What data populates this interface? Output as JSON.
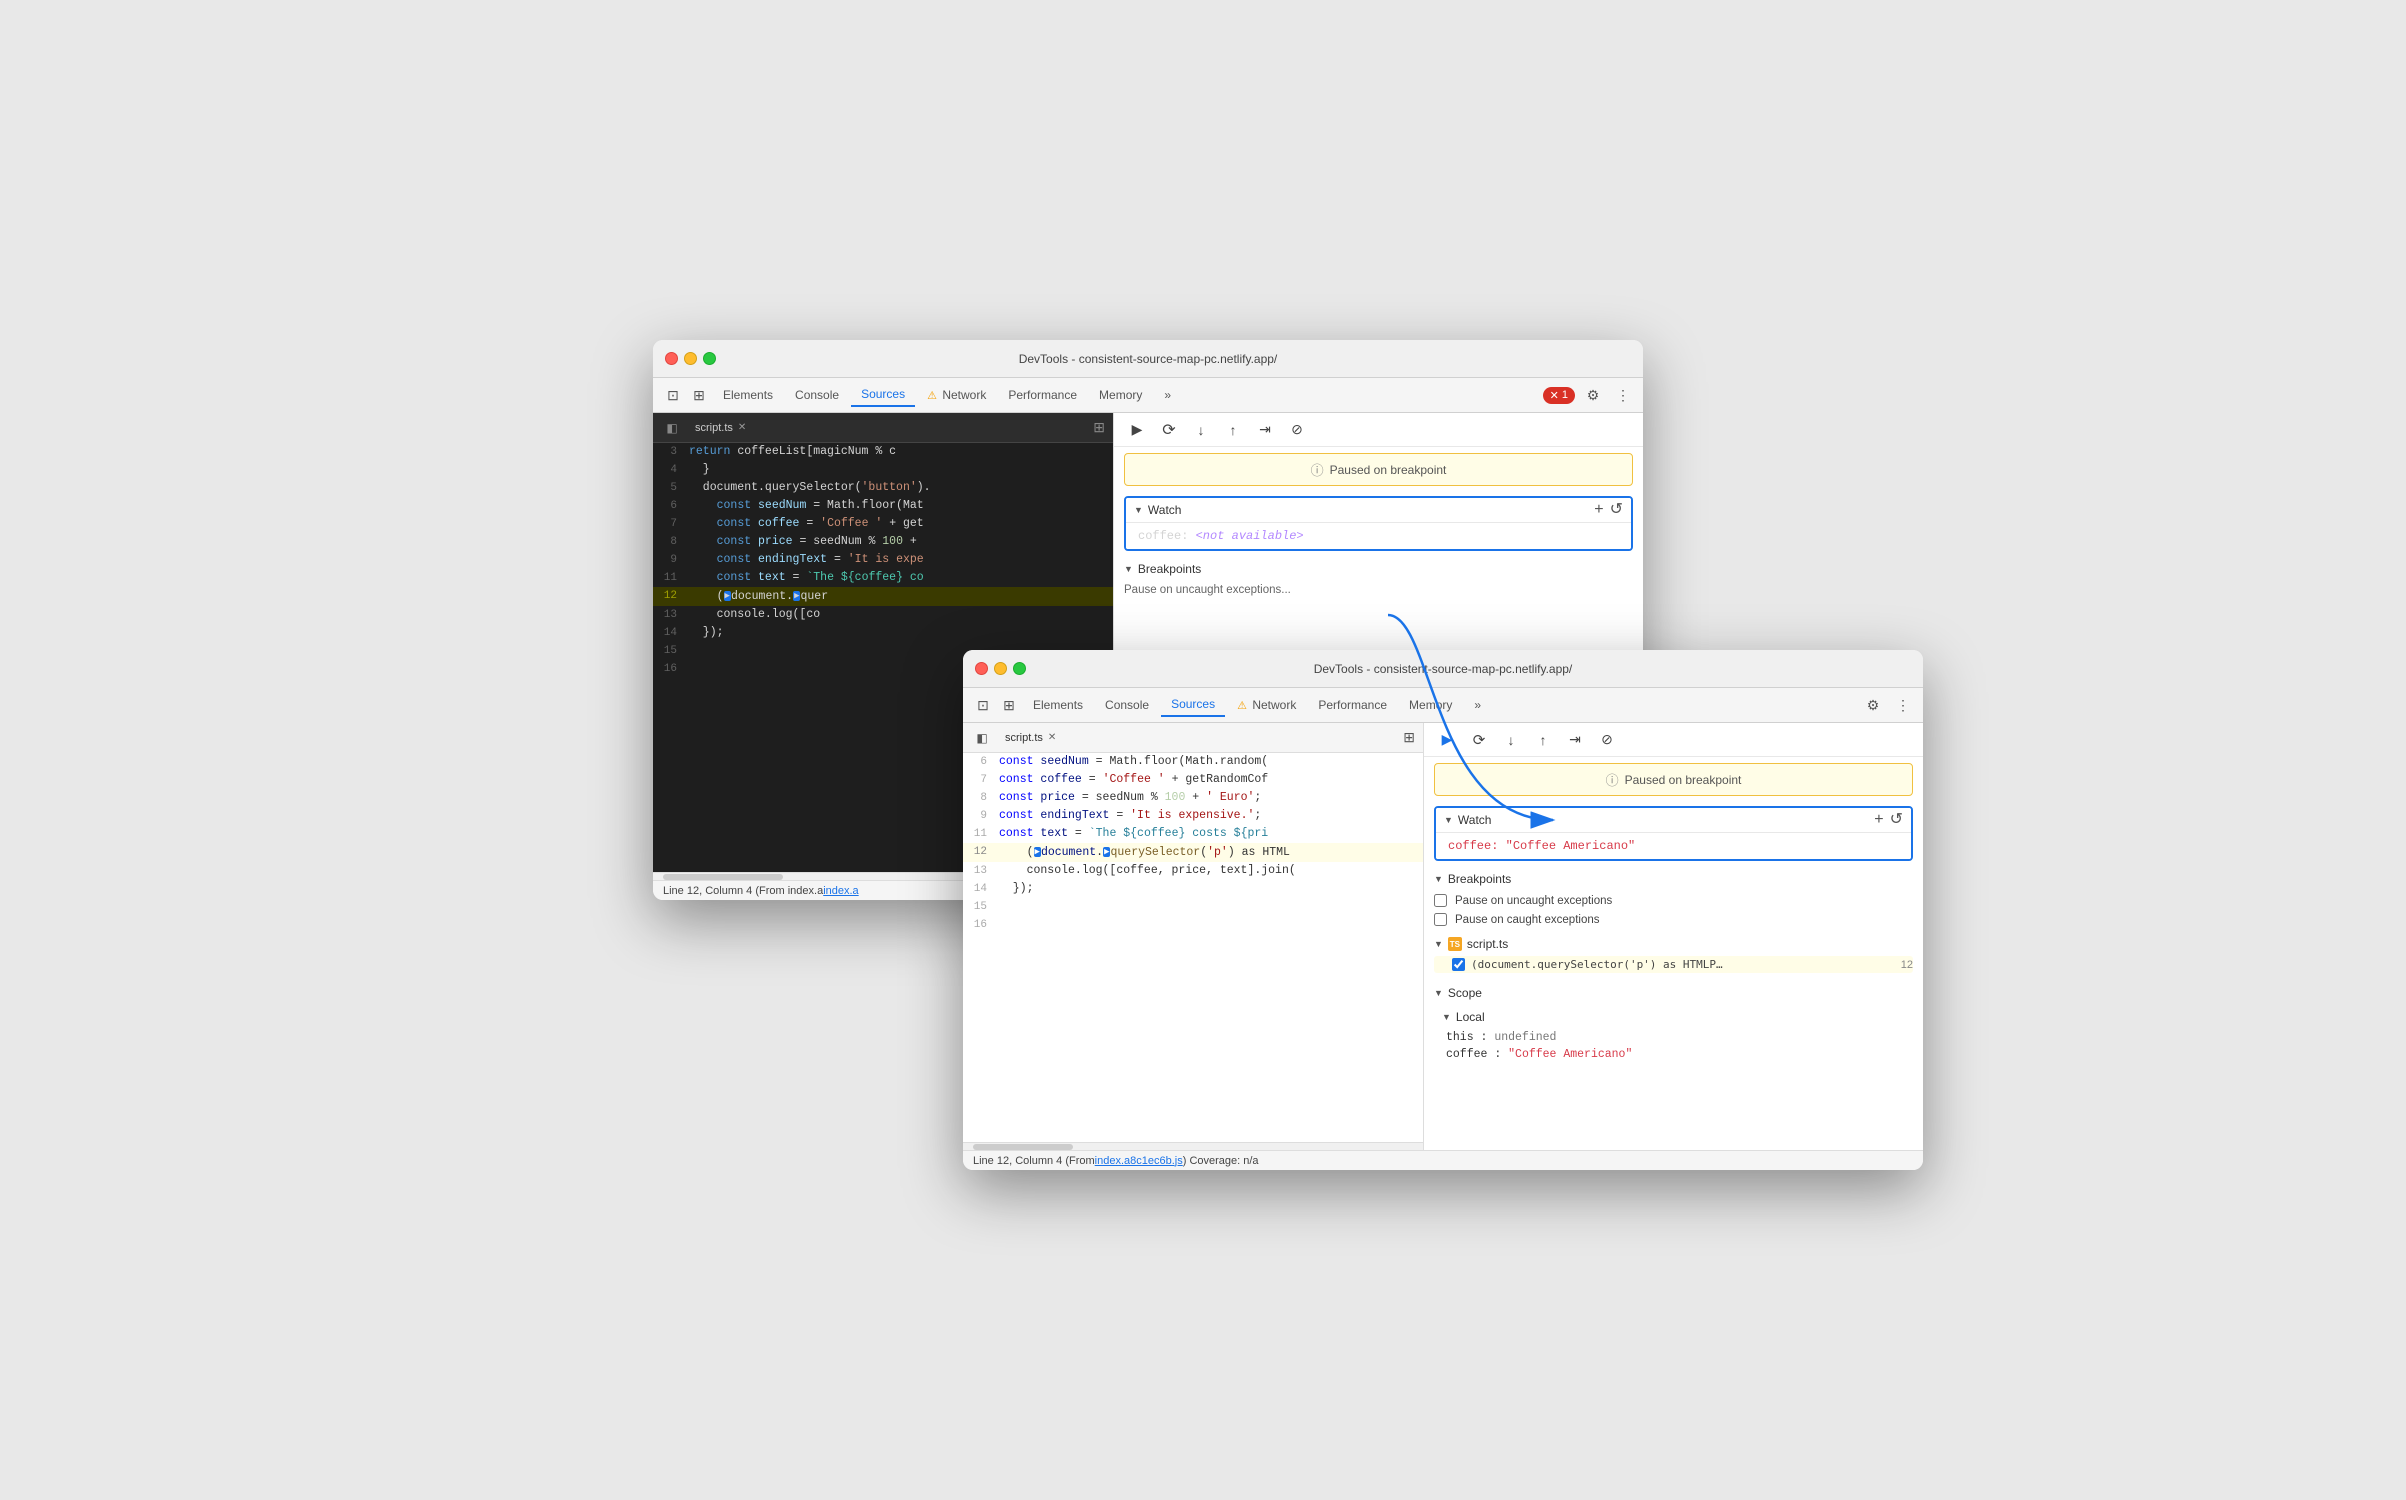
{
  "window_back": {
    "title": "DevTools - consistent-source-map-pc.netlify.app/",
    "tabs": [
      "Elements",
      "Console",
      "Sources",
      "Network",
      "Performance",
      "Memory"
    ],
    "active_tab": "Sources",
    "warning_tab": "Network",
    "error_count": "1",
    "source_file": "script.ts",
    "code_lines": [
      {
        "num": "3",
        "text": "    return coffeeList[magicNum % c",
        "highlight": false
      },
      {
        "num": "4",
        "text": "  }",
        "highlight": false
      },
      {
        "num": "5",
        "text": "  document.querySelector('button').",
        "highlight": false
      },
      {
        "num": "6",
        "text": "    const seedNum = Math.floor(Mat",
        "highlight": false
      },
      {
        "num": "7",
        "text": "    const coffee = 'Coffee ' + get",
        "highlight": false
      },
      {
        "num": "8",
        "text": "    const price = seedNum % 100 +",
        "highlight": false
      },
      {
        "num": "9",
        "text": "    const endingText = 'It is expe",
        "highlight": false
      },
      {
        "num": "11",
        "text": "    const text = `The ${coffee} co",
        "highlight": false
      },
      {
        "num": "12",
        "text": "    (▶document.▶quer",
        "highlight": true
      },
      {
        "num": "13",
        "text": "    console.log([co",
        "highlight": false
      },
      {
        "num": "14",
        "text": "  });",
        "highlight": false
      },
      {
        "num": "15",
        "text": "",
        "highlight": false
      },
      {
        "num": "16",
        "text": "",
        "highlight": false
      }
    ],
    "paused_banner": "Paused on breakpoint",
    "watch_title": "Watch",
    "watch_entry": "coffee: <not available>",
    "breakpoints_title": "Breakpoints",
    "status_bar": "Line 12, Column 4 (From index.a",
    "add_btn": "+",
    "refresh_btn": "↺"
  },
  "window_front": {
    "title": "DevTools - consistent-source-map-pc.netlify.app/",
    "tabs": [
      "Elements",
      "Console",
      "Sources",
      "Network",
      "Performance",
      "Memory"
    ],
    "active_tab": "Sources",
    "warning_tab": "Network",
    "source_file": "script.ts",
    "code_lines": [
      {
        "num": "6",
        "text": "    const seedNum = Math.floor(Math.random(",
        "highlight": false
      },
      {
        "num": "7",
        "text": "    const coffee = 'Coffee ' + getRandomCof",
        "highlight": false
      },
      {
        "num": "8",
        "text": "    const price = seedNum % 100 + ' Euro';",
        "highlight": false
      },
      {
        "num": "9",
        "text": "    const endingText = 'It is expensive.';",
        "highlight": false
      },
      {
        "num": "11",
        "text": "    const text = `The ${coffee} costs ${pri",
        "highlight": false
      },
      {
        "num": "12",
        "text": "    (▶document.▶querySelector('p') as HTML",
        "highlight": true
      },
      {
        "num": "13",
        "text": "    console.log([coffee, price, text].join(",
        "highlight": false
      },
      {
        "num": "14",
        "text": "  });",
        "highlight": false
      },
      {
        "num": "15",
        "text": "",
        "highlight": false
      },
      {
        "num": "16",
        "text": "",
        "highlight": false
      }
    ],
    "paused_banner": "Paused on breakpoint",
    "watch_title": "Watch",
    "watch_entry_key": "coffee",
    "watch_entry_value": "\"Coffee Americano\"",
    "breakpoints_title": "Breakpoints",
    "bp_pause_uncaught": "Pause on uncaught exceptions",
    "bp_pause_caught": "Pause on caught exceptions",
    "bp_file": "script.ts",
    "bp_code": "(document.querySelector('p') as HTMLP…",
    "bp_line": "12",
    "scope_title": "Scope",
    "local_title": "Local",
    "this_label": "this",
    "this_value": "undefined",
    "coffee_label": "coffee",
    "coffee_value": "\"Coffee Americano\"",
    "status_bar": "Line 12, Column 4  (From index.a8c1ec6b.js) Coverage: n/a",
    "status_link": "index.a8c1ec6b.js",
    "add_btn": "+",
    "refresh_btn": "↺"
  },
  "icons": {
    "chevron_right": "▶",
    "chevron_down": "▼",
    "triangle_down": "▾",
    "close": "✕",
    "more": "»",
    "gear": "⚙",
    "dots": "⋮",
    "info": "ⓘ",
    "resume": "▶",
    "step_over": "↷",
    "step_into": "↓",
    "step_out": "↑",
    "step_long": "⇥",
    "deactivate": "⊘",
    "panel_toggle": "◧",
    "sidebar": "◧"
  }
}
